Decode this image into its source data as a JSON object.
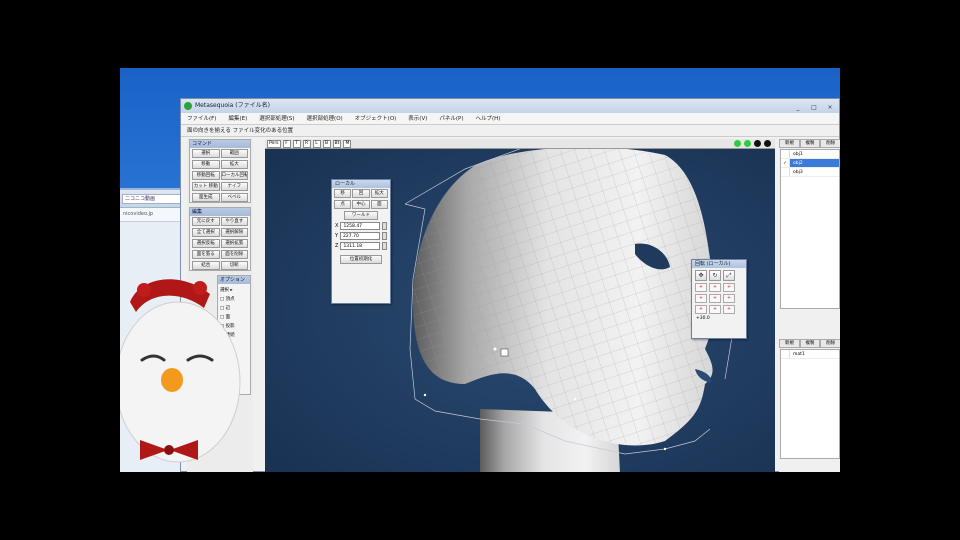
{
  "app": {
    "title": "Metasequoia (ファイル名)",
    "window_controls": [
      "_",
      "□",
      "×"
    ]
  },
  "menubar": {
    "items": [
      "ファイル(F)",
      "編集(E)",
      "選択部処理(S)",
      "選択部処理(O)",
      "オブジェクト(O)",
      "表示(V)",
      "パネル(P)",
      "ヘルプ(H)"
    ]
  },
  "cmdbar": {
    "text": "面の向きを揃える ファイル変化のある位置"
  },
  "left_panel": {
    "command_title": "コマンド",
    "command_buttons": [
      [
        "選択",
        "範囲"
      ],
      [
        "移動",
        "拡大"
      ],
      [
        "移動回転",
        "ローカル回転"
      ],
      [
        "カット 移動",
        "ナイフ"
      ],
      [
        "面生成",
        "ベベル"
      ]
    ],
    "edit_title": "編集",
    "edit_buttons": [
      [
        "元に戻す",
        "やり直す"
      ],
      [
        "全て選択",
        "選択解除"
      ],
      [
        "選択反転",
        "選択拡張"
      ],
      [
        "面を張る",
        "面を削除"
      ],
      [
        "結合",
        "切断"
      ]
    ],
    "option_title": "オプション",
    "option_items": [
      "選択 ▸",
      "□ 頂点",
      "□ 辺",
      "□ 面",
      "□ 投影",
      "□ 連続"
    ]
  },
  "viewport": {
    "toolbar": [
      "Pers",
      "F",
      "T",
      "R",
      "L",
      "B",
      "Bt",
      "M"
    ],
    "view_indicator_colors": [
      "#2ecc40",
      "#2ecc40",
      "#111111",
      "#111111"
    ]
  },
  "move_dialog": {
    "title": "ローカル",
    "buttons_row1": [
      "移",
      "回",
      "拡大"
    ],
    "buttons_row2": [
      "点",
      "中心",
      "面"
    ],
    "apply_label": "ワールド",
    "fields": [
      {
        "axis": "X",
        "value": "1258.47"
      },
      {
        "axis": "Y",
        "value": "227.70"
      },
      {
        "axis": "Z",
        "value": "1311.18"
      }
    ],
    "reset_label": "位置初期化"
  },
  "rotate_dialog": {
    "title": "回転 (ローカル)",
    "icon_names": [
      "move-icon",
      "rotate-icon",
      "scale-icon"
    ],
    "grid_labels": [
      "+",
      "+",
      "+",
      "+",
      "+",
      "+",
      "+",
      "+",
      "+",
      "+",
      "+",
      "+"
    ],
    "footer": "+30.0"
  },
  "right_panel": {
    "top_tabs": [
      "新規",
      "複製",
      "削除"
    ],
    "top_rows": [
      {
        "check": "",
        "name": "obj1",
        "selected": false
      },
      {
        "check": "✓",
        "name": "obj2",
        "selected": true
      },
      {
        "check": "",
        "name": "obj3",
        "selected": false
      }
    ],
    "bottom_tabs": [
      "新規",
      "複製",
      "削除"
    ],
    "bottom_rows": [
      {
        "check": "",
        "name": "mat1",
        "selected": false
      }
    ]
  },
  "browser": {
    "tab_label": "ニコニコ動画",
    "address": "nicovideo.jp"
  }
}
